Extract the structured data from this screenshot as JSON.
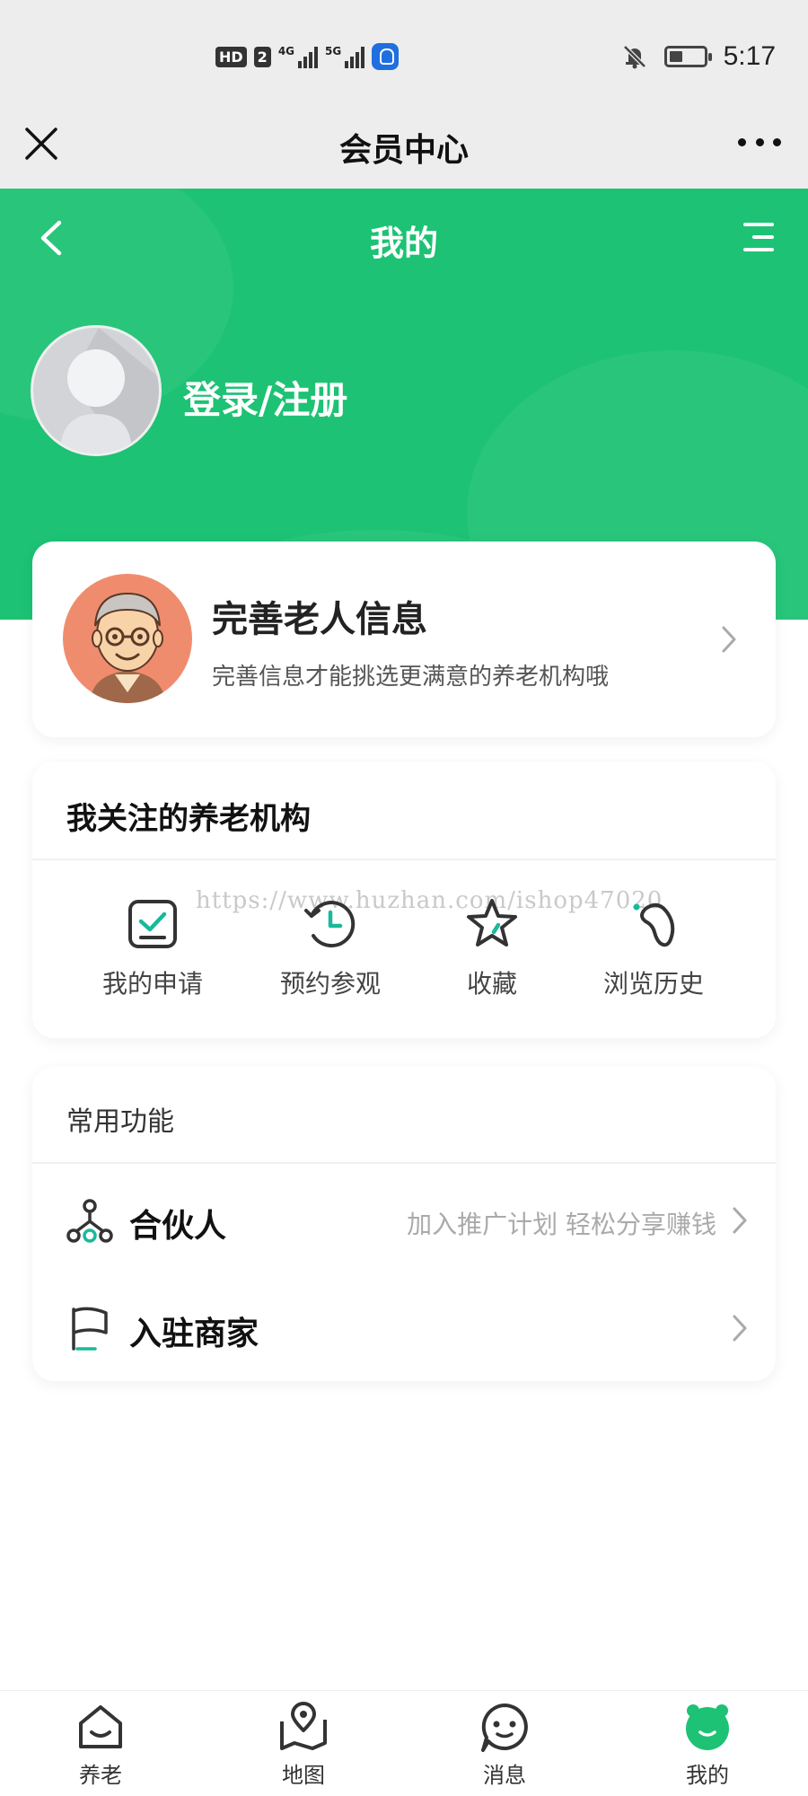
{
  "status_bar": {
    "hd_label": "HD",
    "sim_label": "2",
    "net1": "4G",
    "net2": "5G",
    "time": "5:17"
  },
  "title_bar": {
    "title": "会员中心"
  },
  "header": {
    "title": "我的",
    "login_text": "登录/注册"
  },
  "elder_card": {
    "title": "完善老人信息",
    "subtitle": "完善信息才能挑选更满意的养老机构哦"
  },
  "follow_card": {
    "title": "我关注的养老机构",
    "watermark": "https://www.huzhan.com/ishop47020",
    "items": [
      {
        "label": "我的申请",
        "icon": "application-icon"
      },
      {
        "label": "预约参观",
        "icon": "clock-icon"
      },
      {
        "label": "收藏",
        "icon": "star-icon"
      },
      {
        "label": "浏览历史",
        "icon": "footprint-icon"
      }
    ]
  },
  "common_card": {
    "title": "常用功能",
    "rows": [
      {
        "label": "合伙人",
        "hint": "加入推广计划 轻松分享赚钱",
        "icon": "partner-icon"
      },
      {
        "label": "入驻商家",
        "hint": "",
        "icon": "flag-icon"
      }
    ]
  },
  "tabbar": {
    "items": [
      {
        "label": "养老",
        "icon": "home-icon"
      },
      {
        "label": "地图",
        "icon": "map-icon"
      },
      {
        "label": "消息",
        "icon": "message-icon"
      },
      {
        "label": "我的",
        "icon": "profile-icon"
      }
    ]
  },
  "colors": {
    "brand_green": "#1dc274",
    "accent_teal": "#19b99a"
  }
}
